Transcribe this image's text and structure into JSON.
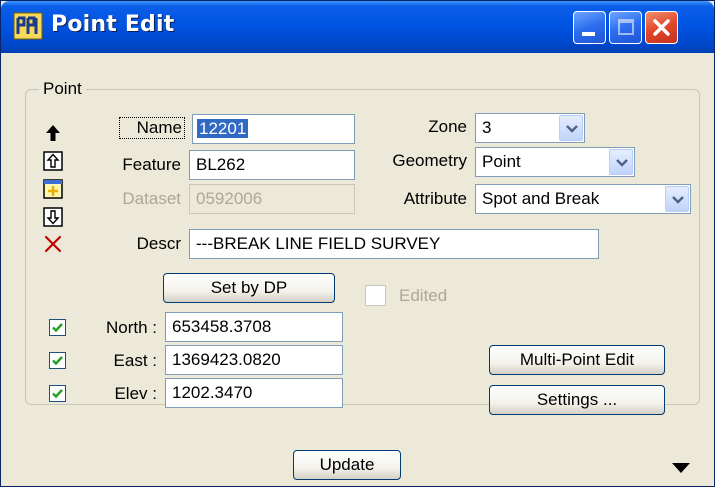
{
  "window": {
    "title": "Point Edit"
  },
  "group": {
    "label": "Point"
  },
  "fields": {
    "name": {
      "label": "Name",
      "value": "12201"
    },
    "feature": {
      "label": "Feature",
      "value": "BL262"
    },
    "dataset": {
      "label": "Dataset",
      "value": "0592006"
    },
    "descr": {
      "label": "Descr",
      "value": "---BREAK LINE FIELD SURVEY"
    }
  },
  "combos": {
    "zone": {
      "label": "Zone",
      "value": "3"
    },
    "geometry": {
      "label": "Geometry",
      "value": "Point"
    },
    "attribute": {
      "label": "Attribute",
      "value": "Spot and Break"
    }
  },
  "coords": {
    "north": {
      "label": "North :",
      "value": "653458.3708",
      "checked": true
    },
    "east": {
      "label": "East :",
      "value": "1369423.0820",
      "checked": true
    },
    "elev": {
      "label": "Elev :",
      "value": "1202.3470",
      "checked": true
    }
  },
  "buttons": {
    "set_by_dp": "Set by DP",
    "multi_point_edit": "Multi-Point Edit",
    "settings": "Settings ...",
    "update": "Update"
  },
  "edited": {
    "label": "Edited",
    "checked": false
  },
  "icons": {
    "first": "arrow-up-icon",
    "previous": "page-up-icon",
    "insert": "insert-icon",
    "next": "page-down-icon",
    "delete": "delete-x-icon",
    "expand": "triangle-down-icon"
  },
  "colors": {
    "titlebar": "#0054e3",
    "face": "#ece9d8",
    "selection": "#316ac5",
    "check": "#21a121",
    "delete": "#c00000"
  }
}
